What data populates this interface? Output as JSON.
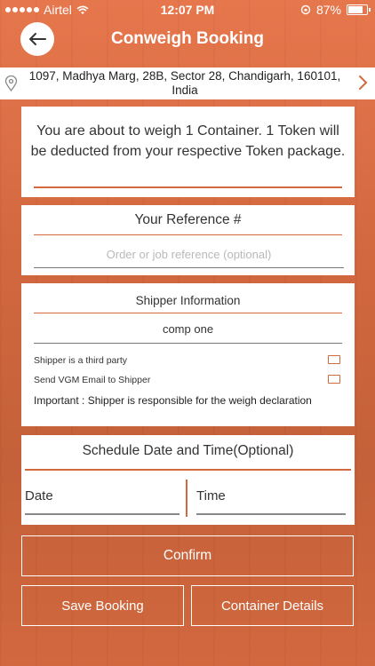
{
  "status_bar": {
    "carrier": "Airtel",
    "time": "12:07 PM",
    "battery": "87%",
    "battery_level": 0.87
  },
  "header": {
    "title": "Conweigh Booking",
    "back_icon": "arrow-left-icon"
  },
  "address_bar": {
    "address": "1097, Madhya Marg, 28B, Sector 28, Chandigarh, 160101, India",
    "pin_icon": "location-pin-icon",
    "chevron_icon": "chevron-right-icon"
  },
  "notice": {
    "message": "You are about to weigh 1 Container. 1 Token will be deducted from your  respective Token package."
  },
  "reference": {
    "heading": "Your Reference #",
    "placeholder": "Order or job reference (optional)",
    "value": ""
  },
  "shipper": {
    "heading": "Shipper Information",
    "company": "comp one",
    "third_party_label": "Shipper is a third party",
    "third_party_checked": false,
    "send_vgm_label": "Send VGM Email to Shipper",
    "send_vgm_checked": false,
    "important": "Important : Shipper is responsible for the weigh declaration"
  },
  "schedule": {
    "heading": "Schedule Date and Time(Optional)",
    "date_placeholder": "Date",
    "time_placeholder": "Time"
  },
  "buttons": {
    "confirm": "Confirm",
    "save_booking": "Save Booking",
    "container_details": "Container Details"
  },
  "colors": {
    "accent": "#d0693e",
    "background": "#c8623b",
    "card": "#ffffff"
  }
}
